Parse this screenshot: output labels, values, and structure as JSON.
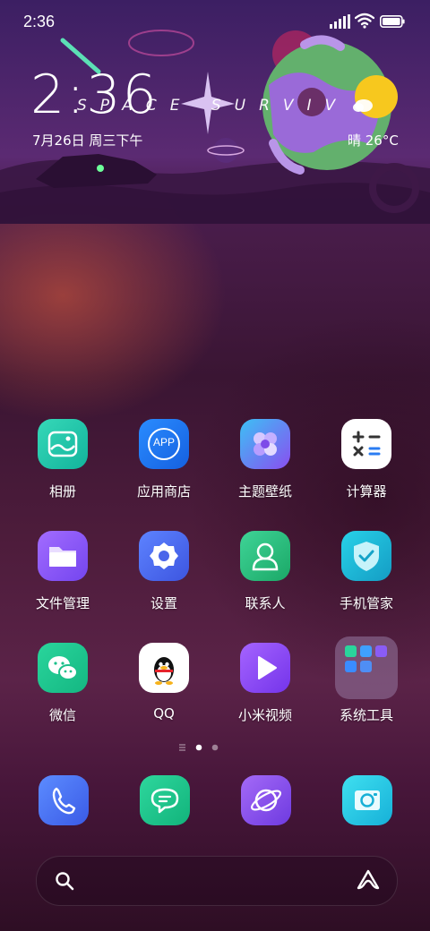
{
  "status_bar": {
    "time": "2:36"
  },
  "widget": {
    "clock": "2:36",
    "date": "7月26日 周三下午",
    "theme_text": "SPACE SURVIV",
    "weather": "晴 26°C"
  },
  "apps": [
    {
      "label": "相册",
      "color": "#1ec7a6"
    },
    {
      "label": "应用商店",
      "color": "#1f7cf2"
    },
    {
      "label": "主题壁纸",
      "color": "#7c5cf2"
    },
    {
      "label": "计算器",
      "color": "#ffffff"
    },
    {
      "label": "文件管理",
      "color": "#8a5cf5"
    },
    {
      "label": "设置",
      "color": "#4f6ef2"
    },
    {
      "label": "联系人",
      "color": "#27c07c"
    },
    {
      "label": "手机管家",
      "color": "#18b8d8"
    },
    {
      "label": "微信",
      "color": "#1dc893"
    },
    {
      "label": "QQ",
      "color": "#ffffff"
    },
    {
      "label": "小米视频",
      "color": "#8b4bf2"
    },
    {
      "label": "系统工具",
      "color": "#7a5a7e"
    }
  ],
  "app_store_icon_text": "APP",
  "dock": [
    {
      "name": "phone"
    },
    {
      "name": "messages"
    },
    {
      "name": "browser"
    },
    {
      "name": "camera"
    }
  ]
}
